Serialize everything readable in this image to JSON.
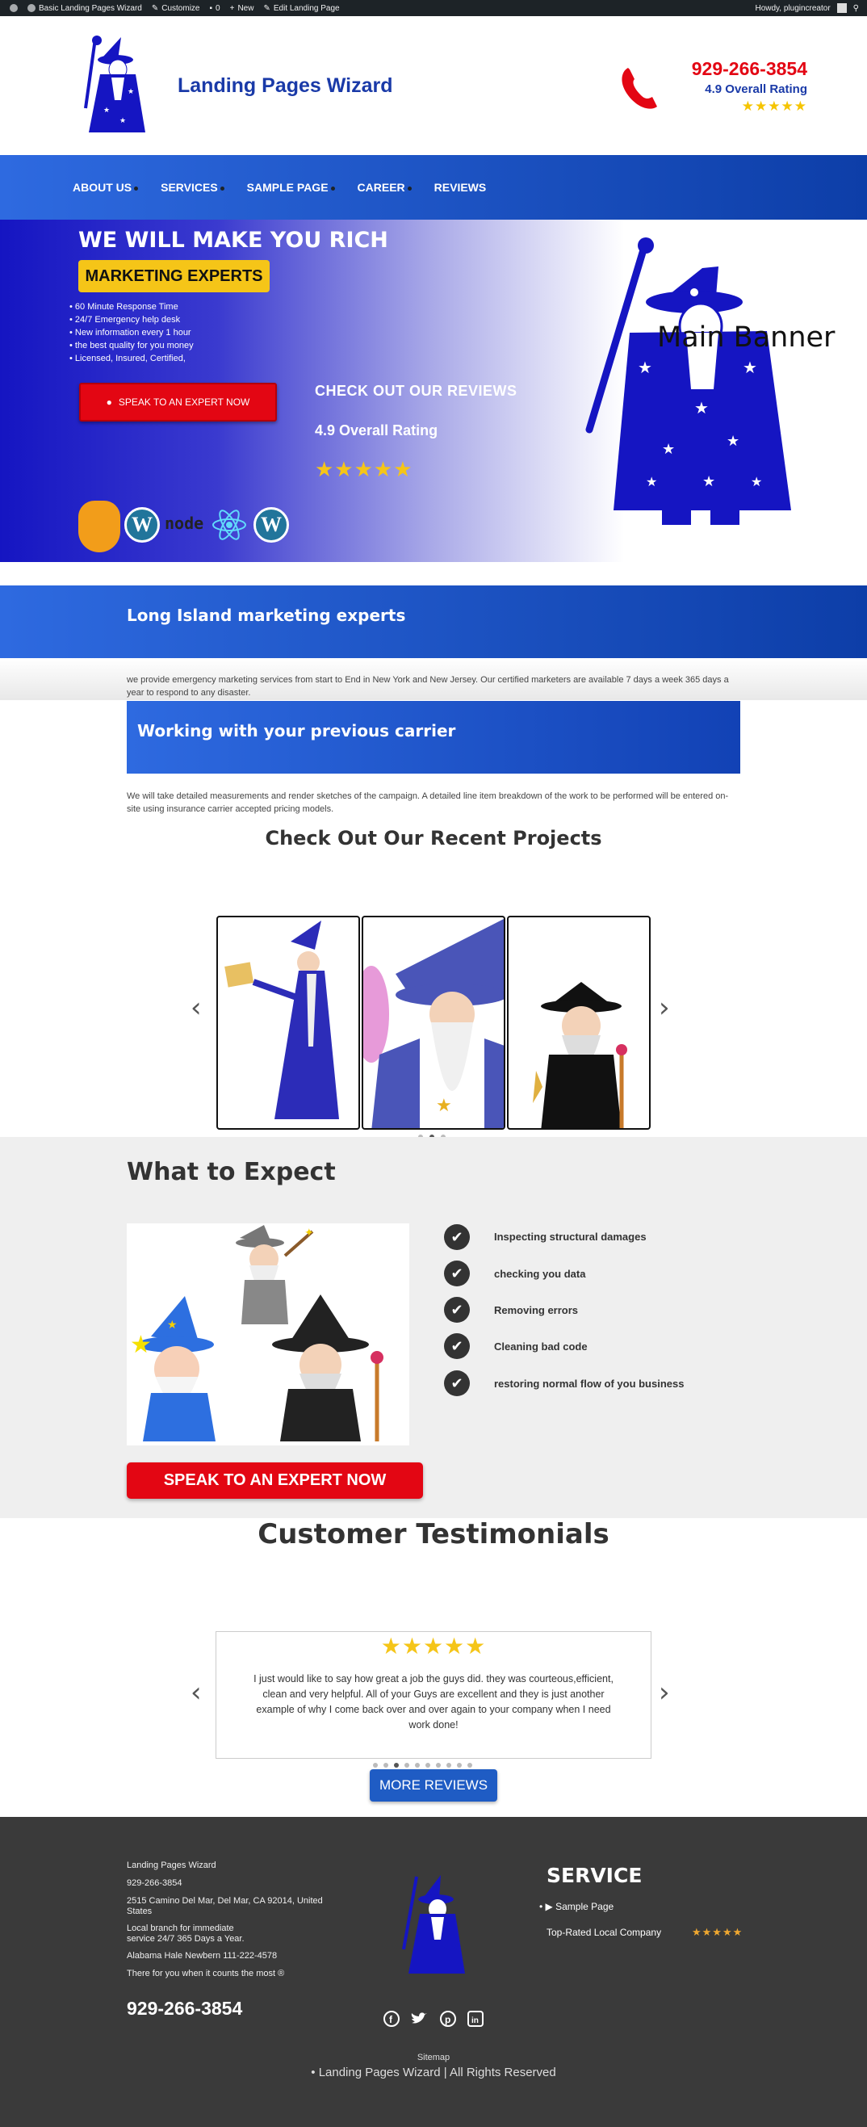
{
  "admin_bar": {
    "items": [
      "Basic Landing Pages Wizard",
      "Customize",
      "0",
      "New",
      "Edit Landing Page"
    ],
    "greeting": "Howdy, plugincreator"
  },
  "header": {
    "site_title": "Landing Pages Wizard",
    "phone": "929-266-3854",
    "rating": "4.9 Overall Rating",
    "stars": "★★★★★"
  },
  "nav": {
    "items": [
      "ABOUT US",
      "SERVICES",
      "SAMPLE PAGE",
      "CAREER",
      "REVIEWS"
    ]
  },
  "hero": {
    "title": "WE WILL MAKE YOU RICH",
    "badge": "MARKETING EXPERTS",
    "list": [
      "60 Minute Response Time",
      "24/7 Emergency help desk",
      "New information every 1 hour",
      "the best quality for you money",
      "Licensed, Insured, Certified,"
    ],
    "cta": "SPEAK TO AN EXPERT NOW",
    "reviews_heading": "CHECK OUT OUR REVIEWS",
    "rating": "4.9 Overall Rating",
    "stars": "★★★★★",
    "banner_label": "Main Banner",
    "tech_logos": [
      "grunt-icon",
      "wordpress-icon",
      "node-icon",
      "react-icon",
      "wordpress-icon"
    ]
  },
  "intro": {
    "band_title": "Long Island marketing experts",
    "paragraph": "we provide emergency marketing services from start to End in New York and New Jersey. Our certified marketers are available 7 days a week 365 days a year to respond to any disaster.",
    "carrier_title": "Working with your previous carrier",
    "carrier_paragraph": "We will take detailed measurements and render sketches of the campaign. A detailed line item breakdown of the work to be performed will be entered on-site using insurance carrier accepted pricing models."
  },
  "projects": {
    "title": "Check Out Our Recent Projects",
    "slide_count": 3,
    "active_dot": 1
  },
  "expect": {
    "title": "What to Expect",
    "items": [
      "Inspecting structural damages",
      "checking you data",
      "Removing errors",
      "Cleaning bad code",
      "restoring normal flow of you business"
    ],
    "cta": "SPEAK TO AN EXPERT NOW"
  },
  "testimonials": {
    "title": "Customer Testimonials",
    "stars": "★★★★★",
    "quote": "I just would like to say how great a job the guys did. they was courteous,efficient, clean and very helpful. All of your Guys are excellent and they is just another example of why I come back over and over again to your company when I need work done!",
    "dot_count": 10,
    "active_dot": 2,
    "more_button": "MORE REVIEWS"
  },
  "footer": {
    "company": "Landing Pages Wizard",
    "phone_small": "929-266-3854",
    "address": "2515 Camino Del Mar, Del Mar, CA 92014, United States",
    "branch": "Local branch for immediate service 24/7 365 Days a Year.",
    "alabama": "Alabama Hale Newbern 111-222-4578",
    "tagline": "There for you when it counts the most ®",
    "phone_big": "929-266-3854",
    "service_heading": "SERVICE",
    "service_link": "Sample Page",
    "top_rated": "Top-Rated Local Company",
    "top_rated_stars": "★★★★★",
    "social": [
      "facebook-icon",
      "twitter-icon",
      "pinterest-icon",
      "linkedin-icon"
    ],
    "sitemap": "Sitemap",
    "copyright": "Landing Pages Wizard | All Rights Reserved"
  },
  "colors": {
    "brand_blue": "#1a3aa8",
    "accent_red": "#e30613",
    "gold": "#f5c518",
    "footer_bg": "#3a3a3a"
  }
}
